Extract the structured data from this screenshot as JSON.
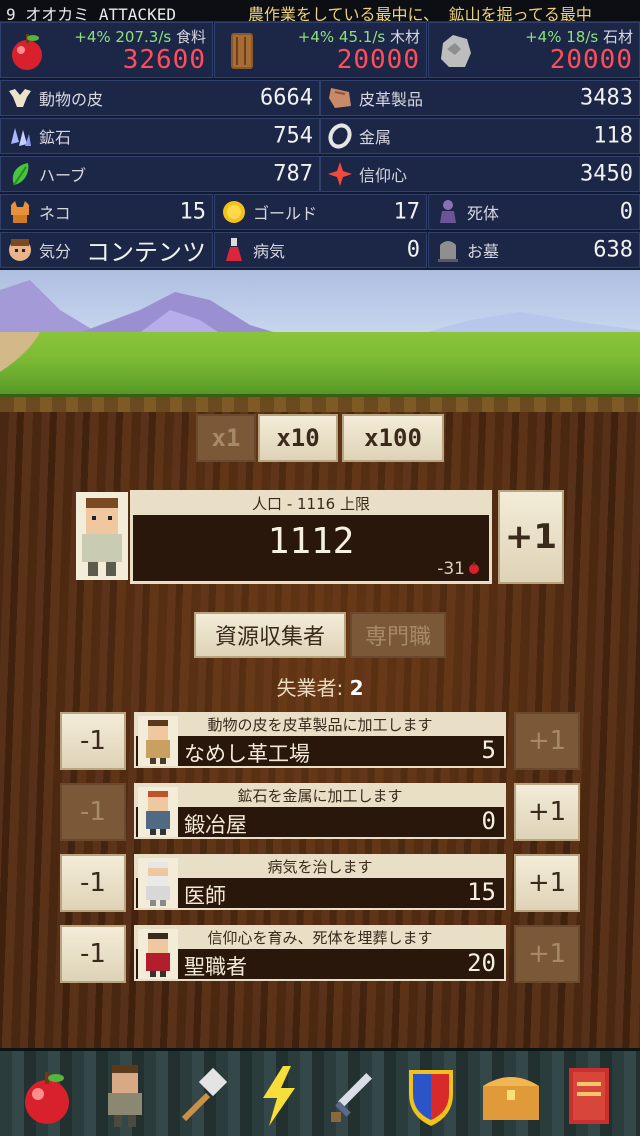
{
  "ticker": {
    "left": "9 オオカミ ATTACKED",
    "right": "農作業をしている最中に、 鉱山を掘ってる最中"
  },
  "header": {
    "food": {
      "rate": "+4% 207.3/s",
      "label": "食料",
      "amount": "32600",
      "icon": "apple-icon"
    },
    "wood": {
      "rate": "+4% 45.1/s",
      "label": "木材",
      "amount": "20000",
      "icon": "log-icon"
    },
    "stone": {
      "rate": "+4% 18/s",
      "label": "石材",
      "amount": "20000",
      "icon": "stone-icon"
    },
    "rows": [
      [
        {
          "label": "動物の皮",
          "value": "6664",
          "icon": "skull-icon"
        },
        {
          "label": "皮革製品",
          "value": "3483",
          "icon": "leather-icon"
        }
      ],
      [
        {
          "label": "鉱石",
          "value": "754",
          "icon": "ore-icon"
        },
        {
          "label": "金属",
          "value": "118",
          "icon": "metal-ring-icon"
        }
      ],
      [
        {
          "label": "ハーブ",
          "value": "787",
          "icon": "herb-icon"
        },
        {
          "label": "信仰心",
          "value": "3450",
          "icon": "piety-icon"
        }
      ]
    ],
    "row4": [
      {
        "label": "ネコ",
        "value": "15",
        "icon": "cat-icon"
      },
      {
        "label": "ゴールド",
        "value": "17",
        "icon": "gold-icon"
      },
      {
        "label": "死体",
        "value": "0",
        "icon": "corpse-icon"
      }
    ],
    "row5": [
      {
        "label": "気分",
        "value": "コンテンツ",
        "icon": "mood-face-icon"
      },
      {
        "label": "病気",
        "value": "0",
        "icon": "potion-icon"
      },
      {
        "label": "お墓",
        "value": "638",
        "icon": "grave-icon"
      }
    ]
  },
  "multiplier": {
    "x1": "x1",
    "x10": "x10",
    "x100": "x100"
  },
  "population": {
    "caption": "人口 - 1116 上限",
    "count": "1112",
    "food": "-31",
    "plus_label": "+1"
  },
  "tabs": {
    "gatherers": "資源収集者",
    "specialists": "専門職"
  },
  "unemployed": {
    "label": "失業者:",
    "value": "2"
  },
  "jobs": [
    {
      "desc": "動物の皮を皮革製品に加工します",
      "name": "なめし革工場",
      "count": "5",
      "minus": "-1",
      "plus": "+1"
    },
    {
      "desc": "鉱石を金属に加工します",
      "name": "鍛冶屋",
      "count": "0",
      "minus": "-1",
      "plus": "+1"
    },
    {
      "desc": "病気を治します",
      "name": "医師",
      "count": "15",
      "minus": "-1",
      "plus": "+1"
    },
    {
      "desc": "信仰心を育み、死体を埋葬します",
      "name": "聖職者",
      "count": "20",
      "minus": "-1",
      "plus": "+1"
    }
  ],
  "bottom_bar": [
    "apple-icon",
    "villager-icon",
    "hammer-icon",
    "lightning-icon",
    "sword-icon",
    "shield-icon",
    "chest-icon",
    "book-icon"
  ]
}
